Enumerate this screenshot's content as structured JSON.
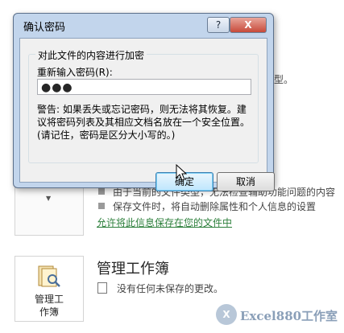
{
  "dialog": {
    "title": "确认密码",
    "help_label": "?",
    "close_label": "X",
    "group_label": "对此文件的内容进行加密",
    "password_label": "重新输入密码(R):",
    "password_value": "●●●",
    "warning": "警告: 如果丢失或忘记密码，则无法将其恢复。建议将密码列表及其相应文档名放在一个安全位置。\n(请记住，密码是区分大小写的。)",
    "ok_label": "确定",
    "cancel_label": "取消"
  },
  "background": {
    "fragment_right": "型。",
    "line1": "由于当前的文件类型，无法检查辅助功能问题的内容",
    "line2": "保存文件时，将自动删除属性和个人信息的设置",
    "link": "允许将此信息保存在您的文件中",
    "manage": {
      "tile_label_1": "管理工",
      "tile_label_2": "作簿",
      "title": "管理工作簿",
      "desc": "没有任何未保存的更改。"
    },
    "watermark_logo": "X",
    "watermark": "Excel880工作室"
  }
}
